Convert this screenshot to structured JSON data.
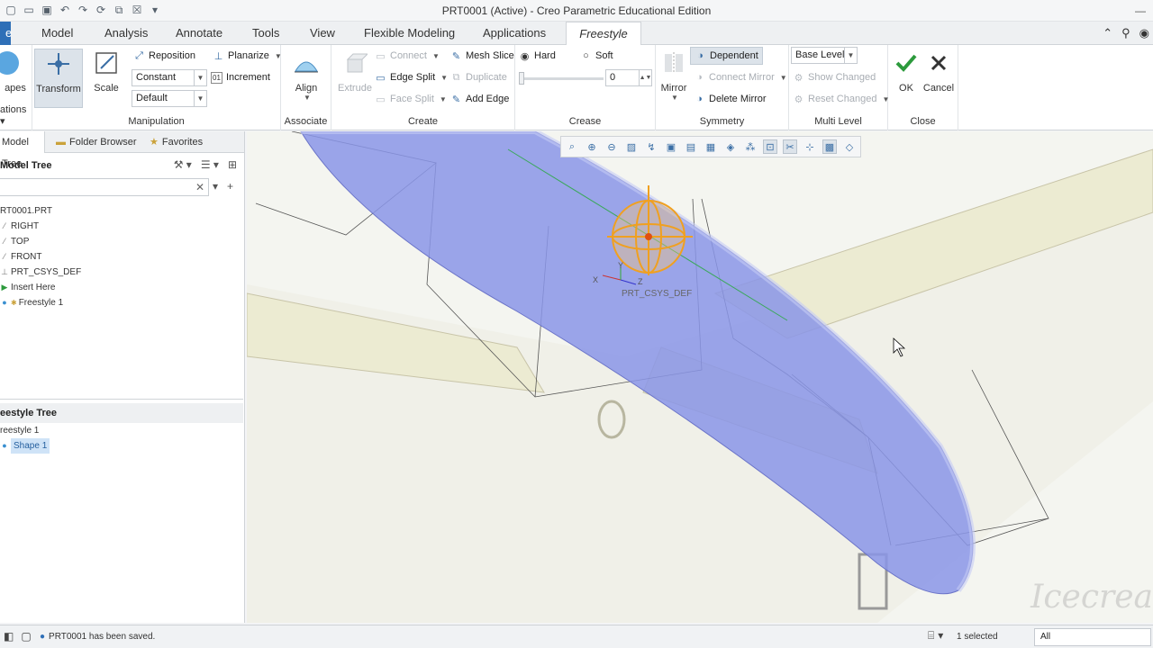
{
  "window": {
    "title": "PRT0001 (Active) - Creo Parametric Educational Edition"
  },
  "tabs": [
    {
      "label": "e"
    },
    {
      "label": "Model"
    },
    {
      "label": "Analysis"
    },
    {
      "label": "Annotate"
    },
    {
      "label": "Tools"
    },
    {
      "label": "View"
    },
    {
      "label": "Flexible Modeling"
    },
    {
      "label": "Applications"
    },
    {
      "label": "Freestyle"
    }
  ],
  "ribbon": {
    "shapes": {
      "label": "apes",
      "group": "ations"
    },
    "manipulation": {
      "group": "Manipulation",
      "transform": "Transform",
      "scale": "Scale",
      "reposition": "Reposition",
      "planarize": "Planarize",
      "increment": "Increment",
      "mode_value": "Constant",
      "level_value": "Default"
    },
    "associate": {
      "group": "Associate",
      "align": "Align"
    },
    "create": {
      "group": "Create",
      "extrude": "Extrude",
      "connect": "Connect",
      "edge_split": "Edge Split",
      "face_split": "Face Split",
      "mesh_slice": "Mesh Slice",
      "duplicate": "Duplicate",
      "add_edge": "Add Edge"
    },
    "crease": {
      "group": "Crease",
      "hard": "Hard",
      "soft": "Soft",
      "value": "0"
    },
    "symmetry": {
      "group": "Symmetry",
      "mirror": "Mirror",
      "dependent": "Dependent",
      "connect_mirror": "Connect Mirror",
      "delete_mirror": "Delete Mirror"
    },
    "multilevel": {
      "group": "Multi Level",
      "base_level": "Base Level",
      "show_changed": "Show Changed",
      "reset_changed": "Reset Changed"
    },
    "close": {
      "group": "Close",
      "ok": "OK",
      "cancel": "Cancel"
    }
  },
  "left_panel": {
    "tabs": [
      "Model Tree",
      "Folder Browser",
      "Favorites"
    ],
    "header": "Model Tree",
    "tree": [
      {
        "label": "RT0001.PRT"
      },
      {
        "label": "RIGHT"
      },
      {
        "label": "TOP"
      },
      {
        "label": "FRONT"
      },
      {
        "label": "PRT_CSYS_DEF"
      },
      {
        "label": "Insert Here"
      },
      {
        "label": "Freestyle 1"
      }
    ],
    "freestyle_header": "eestyle Tree",
    "freestyle_tree": [
      {
        "label": "reestyle 1"
      },
      {
        "label": "Shape 1"
      }
    ]
  },
  "viewport": {
    "csys_label": "PRT_CSYS_DEF",
    "axis_x": "X",
    "axis_y": "Y",
    "axis_z": "Z"
  },
  "statusbar": {
    "message": "PRT0001 has been saved.",
    "selected": "1 selected",
    "filter": "All"
  },
  "colors": {
    "accent": "#2e6fb7",
    "body_fill": "#8a95e8",
    "handle": "#f0a020"
  }
}
